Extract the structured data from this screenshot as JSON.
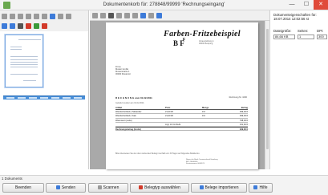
{
  "window": {
    "title": "Dokumentenkorb für: 278848/99999 'Rechnungseingang'",
    "min_glyph": "—",
    "max_glyph": "☐",
    "close_glyph": "✕"
  },
  "left_toolbar": {
    "row1_icons": [
      "first-page-icon",
      "prev-page-icon",
      "next-page-icon",
      "last-page-icon",
      "rotate-left-icon",
      "rotate-right-icon",
      "split-icon",
      "merge-icon",
      "print-icon"
    ],
    "row2_icons": [
      "scan-icon",
      "select-icon",
      "thumbnail-icon",
      "delete-icon",
      "add-page-icon",
      "settings-icon"
    ]
  },
  "view_toolbar": {
    "icons": [
      "save-icon",
      "open-icon",
      "print-icon",
      "zoom-in-icon",
      "zoom-out-icon",
      "fit-page-icon",
      "fit-width-icon",
      "copy-icon",
      "search-icon"
    ]
  },
  "document": {
    "company_name": "Farben-Fritzebeispiel",
    "logo_letters": "B F",
    "logo_top_letter": "F",
    "logo_subtext": [
      "Vorauszahlung 1",
      "00000 Beisping"
    ],
    "address_lines": [
      "Firma",
      "Muster GmbH",
      "Musterstraße 1",
      "00000 Musterort"
    ],
    "heading": "R E C H N U N G vom 01.02.2011",
    "reference": "Rechnung Nr. 1000",
    "note": "Geliefert wurden am 01.02.2011:",
    "table": {
      "headers": [
        "Artikel",
        "Preis",
        "Menge",
        "Betrag"
      ],
      "rows": [
        [
          "Wandschutzlack, Palisander",
          "21,00 €/l",
          "19 l",
          "399,00 €"
        ],
        [
          "Wandschutzlack, Teak",
          "21,00 €/l",
          "19 l",
          "399,00 €"
        ],
        [
          "Warenwert (netto)",
          "",
          "",
          "798,00 €"
        ],
        [
          "",
          "zzgl. 19 % MwSt",
          "",
          "151,62 €"
        ]
      ],
      "total_label": "Rechnungsbetrag (brutto)",
      "total_value": "949,62 €"
    },
    "footnote": "Bitte überweisen Sie den oben stehenden Betrag innerhalb von 30 Tagen auf folgendes Bankkonto.",
    "bank_lines": [
      "Name der Bank   Commerzbank Hamburg",
      "BLZ   20040000",
      "Kontonummer   0040123"
    ]
  },
  "properties": {
    "title": "Dokumenteigenschaften für: 18.07.2014 12:02:56 st",
    "labels": [
      "Dateigröße:",
      "Seiten:",
      "DPI:"
    ],
    "values": [
      "84,66 KB",
      "1",
      "300"
    ]
  },
  "status": {
    "text": "1 Dokuments"
  },
  "buttons": [
    {
      "label": "Beenden",
      "icon": ""
    },
    {
      "label": "Senden",
      "icon": "send-icon"
    },
    {
      "label": "Scannen",
      "icon": "scan-icon"
    },
    {
      "label": "Belegtyp auswählen",
      "icon": "doc-type-icon"
    },
    {
      "label": "Belege importieren",
      "icon": "import-icon"
    },
    {
      "label": "Hilfe",
      "icon": "help-icon"
    }
  ]
}
